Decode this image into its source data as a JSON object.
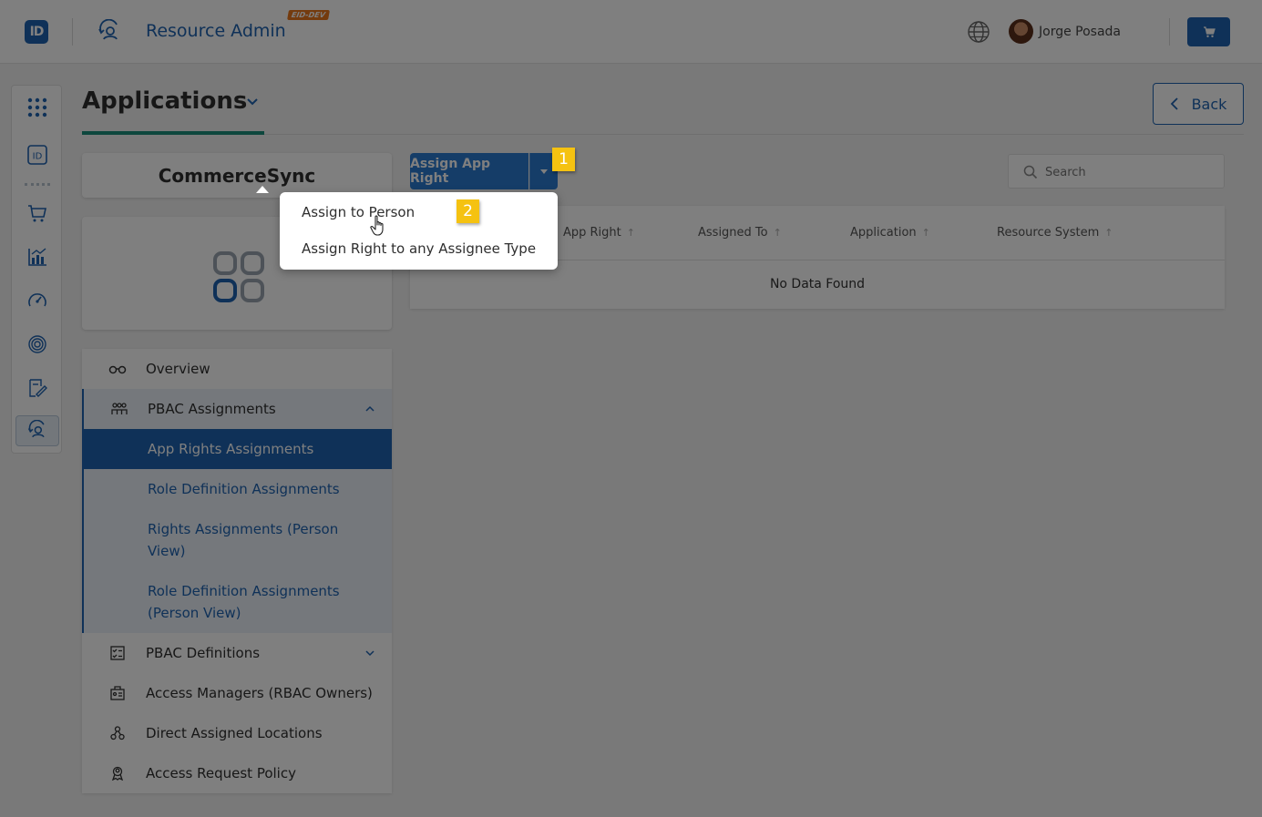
{
  "header": {
    "logo_text": "ID",
    "app_title": "Resource Admin",
    "env_badge": "EID-DEV",
    "user_name": "Jorge Posada"
  },
  "rail": {
    "icons": [
      "apps-grid-icon",
      "id-card-icon",
      "cart-icon",
      "analytics-icon",
      "speedometer-icon",
      "fingerprint-icon",
      "signature-icon",
      "resource-admin-icon"
    ],
    "active": "resource-admin-icon"
  },
  "page": {
    "title": "Applications",
    "back_label": "Back"
  },
  "app": {
    "name": "CommerceSync"
  },
  "nav": {
    "overview": "Overview",
    "pbac_assignments": "PBAC Assignments",
    "sub_items": [
      "App Rights Assignments",
      "Role Definition Assignments",
      "Rights Assignments (Person View)",
      "Role Definition Assignments (Person View)"
    ],
    "active_sub": "App Rights Assignments",
    "pbac_definitions": "PBAC Definitions",
    "access_managers": "Access Managers (RBAC Owners)",
    "direct_locations": "Direct Assigned Locations",
    "access_request_policy": "Access Request Policy"
  },
  "toolbar": {
    "assign_label": "Assign App Right",
    "search_placeholder": "Search"
  },
  "grid": {
    "columns": [
      "App Right",
      "Assigned To",
      "Application",
      "Resource System"
    ],
    "empty_text": "No Data Found"
  },
  "dropdown": {
    "items": [
      "Assign to Person",
      "Assign Right to any Assignee Type"
    ]
  },
  "steps": [
    "1",
    "2"
  ],
  "colors": {
    "primary": "#1f63b0",
    "button": "#2b7ad1",
    "accent": "#1b8f7a",
    "step_badge": "#f5c211",
    "env_badge": "#e8771c"
  }
}
